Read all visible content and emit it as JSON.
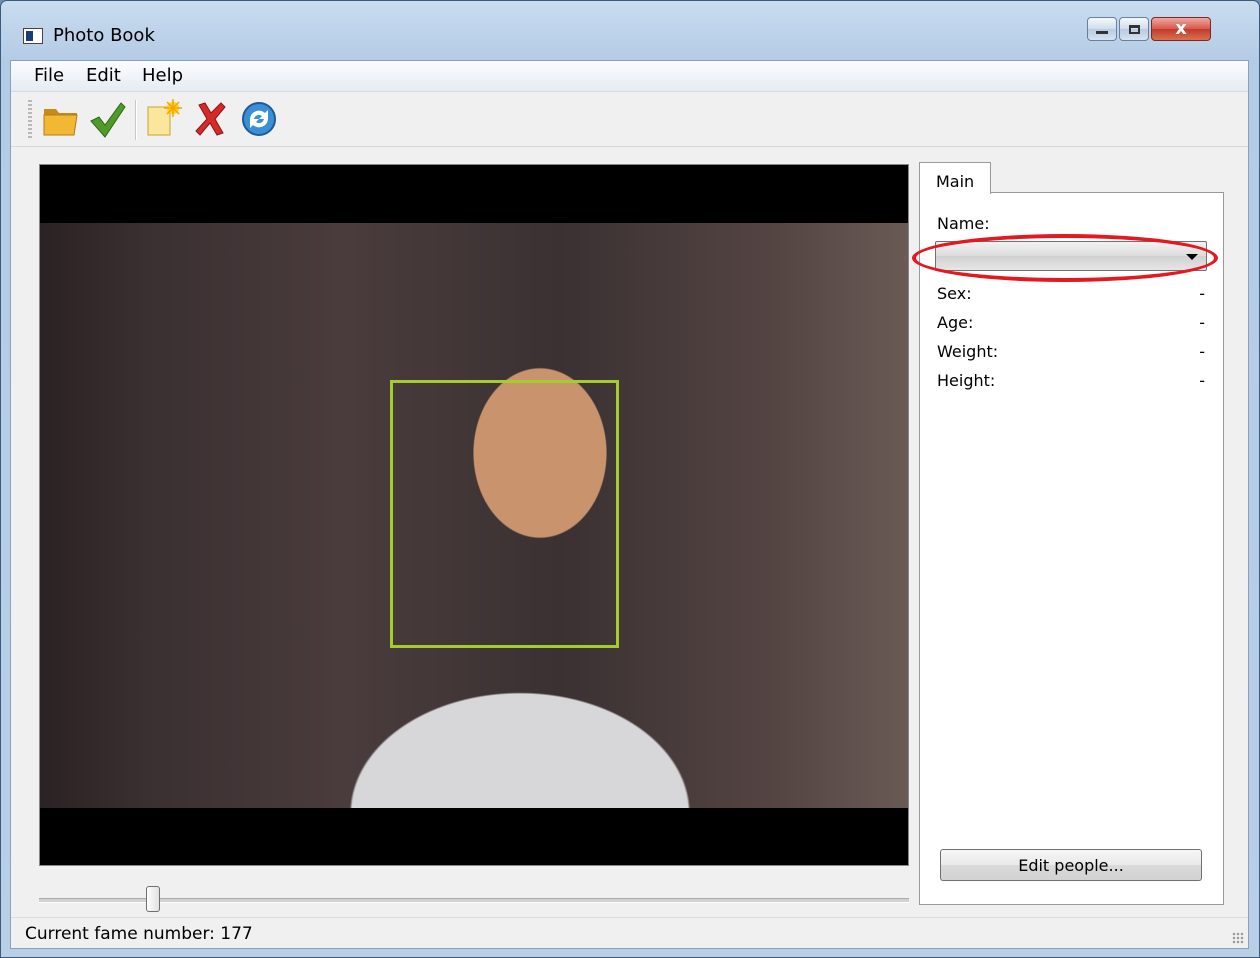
{
  "window": {
    "title": "Photo Book"
  },
  "window_controls": {
    "close_glyph": "x"
  },
  "menu": {
    "items": [
      "File",
      "Edit",
      "Help"
    ]
  },
  "toolbar": {
    "icons": [
      "open-folder-icon",
      "checkmark-icon",
      "new-item-icon",
      "delete-icon",
      "refresh-icon"
    ]
  },
  "video": {
    "face_box_color": "#a2cd2c"
  },
  "slider": {
    "position_fraction": 0.125
  },
  "side_panel": {
    "tab": "Main",
    "name_label": "Name:",
    "name_value": "",
    "fields": [
      {
        "label": "Sex:",
        "value": "-"
      },
      {
        "label": "Age:",
        "value": "-"
      },
      {
        "label": "Weight:",
        "value": "-"
      },
      {
        "label": "Height:",
        "value": "-"
      }
    ],
    "highlight_color": "#e4181e",
    "edit_button": "Edit people..."
  },
  "status": {
    "text": "Current fame number: 177"
  }
}
